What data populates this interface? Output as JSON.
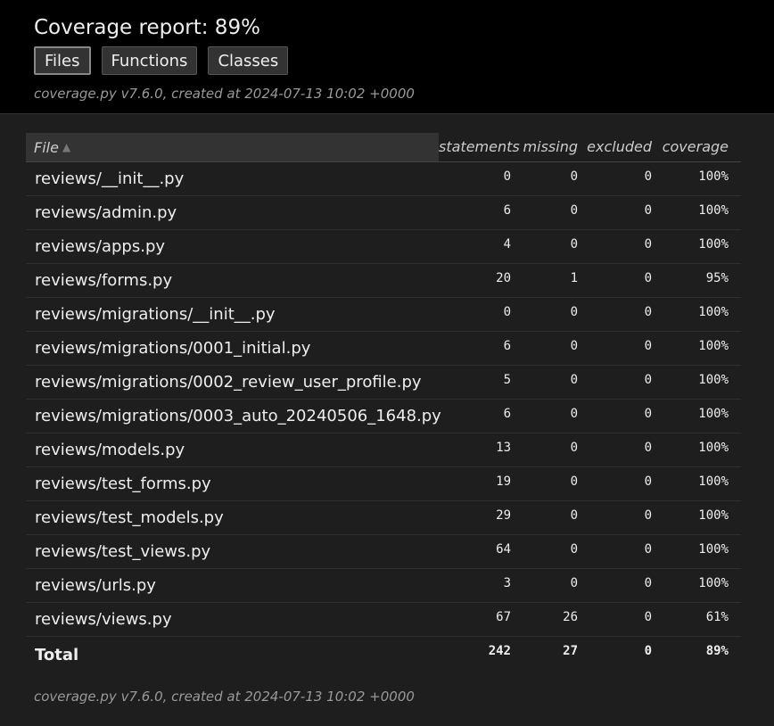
{
  "header": {
    "title": "Coverage report: 89%",
    "buttons": [
      "Files",
      "Functions",
      "Classes"
    ],
    "created": "coverage.py v7.6.0, created at 2024-07-13 10:02 +0000"
  },
  "table": {
    "columns": {
      "file": "File",
      "statements": "statements",
      "missing": "missing",
      "excluded": "excluded",
      "coverage": "coverage"
    },
    "rows": [
      {
        "file": "reviews/__init__.py",
        "statements": "0",
        "missing": "0",
        "excluded": "0",
        "coverage": "100%"
      },
      {
        "file": "reviews/admin.py",
        "statements": "6",
        "missing": "0",
        "excluded": "0",
        "coverage": "100%"
      },
      {
        "file": "reviews/apps.py",
        "statements": "4",
        "missing": "0",
        "excluded": "0",
        "coverage": "100%"
      },
      {
        "file": "reviews/forms.py",
        "statements": "20",
        "missing": "1",
        "excluded": "0",
        "coverage": "95%"
      },
      {
        "file": "reviews/migrations/__init__.py",
        "statements": "0",
        "missing": "0",
        "excluded": "0",
        "coverage": "100%"
      },
      {
        "file": "reviews/migrations/0001_initial.py",
        "statements": "6",
        "missing": "0",
        "excluded": "0",
        "coverage": "100%"
      },
      {
        "file": "reviews/migrations/0002_review_user_profile.py",
        "statements": "5",
        "missing": "0",
        "excluded": "0",
        "coverage": "100%"
      },
      {
        "file": "reviews/migrations/0003_auto_20240506_1648.py",
        "statements": "6",
        "missing": "0",
        "excluded": "0",
        "coverage": "100%"
      },
      {
        "file": "reviews/models.py",
        "statements": "13",
        "missing": "0",
        "excluded": "0",
        "coverage": "100%"
      },
      {
        "file": "reviews/test_forms.py",
        "statements": "19",
        "missing": "0",
        "excluded": "0",
        "coverage": "100%"
      },
      {
        "file": "reviews/test_models.py",
        "statements": "29",
        "missing": "0",
        "excluded": "0",
        "coverage": "100%"
      },
      {
        "file": "reviews/test_views.py",
        "statements": "64",
        "missing": "0",
        "excluded": "0",
        "coverage": "100%"
      },
      {
        "file": "reviews/urls.py",
        "statements": "3",
        "missing": "0",
        "excluded": "0",
        "coverage": "100%"
      },
      {
        "file": "reviews/views.py",
        "statements": "67",
        "missing": "26",
        "excluded": "0",
        "coverage": "61%"
      }
    ],
    "total": {
      "file": "Total",
      "statements": "242",
      "missing": "27",
      "excluded": "0",
      "coverage": "89%"
    }
  },
  "footer": {
    "created": "coverage.py v7.6.0, created at 2024-07-13 10:02 +0000"
  },
  "icons": {
    "sort": "sort-ascending-icon"
  },
  "colors": {
    "header_bg": "#000000",
    "page_bg": "#1e1e1e",
    "text": "#eeeeee",
    "muted": "#999999"
  }
}
